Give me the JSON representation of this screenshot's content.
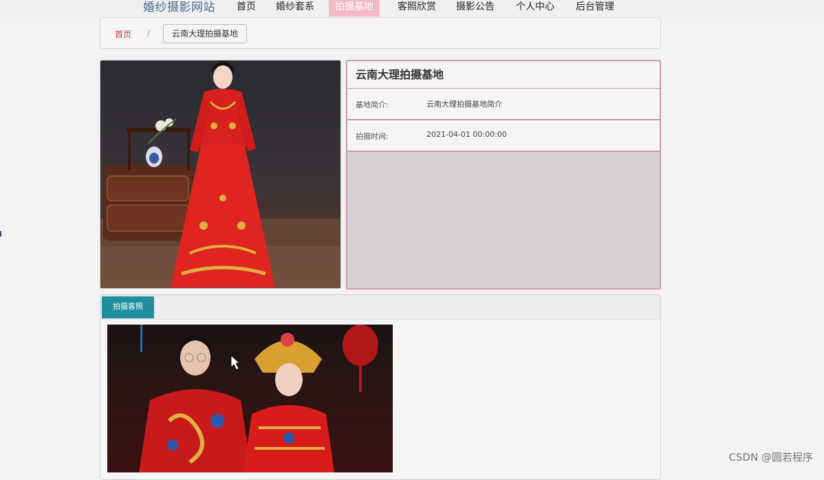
{
  "nav": {
    "brand": "婚纱摄影网站",
    "items": [
      "首页",
      "婚纱套系",
      "拍摄基地",
      "客照欣赏",
      "摄影公告",
      "个人中心",
      "后台管理"
    ],
    "active_index": 2
  },
  "breadcrumb": {
    "home": "首页",
    "separator": "/",
    "current": "云南大理拍摄基地"
  },
  "detail": {
    "title": "云南大理拍摄基地",
    "rows": [
      {
        "label": "基地简介:",
        "value": "云南大理拍摄基地简介"
      },
      {
        "label": "拍摄时间:",
        "value": "2021-04-01 00:00:00"
      }
    ]
  },
  "tabs": {
    "active_label": "拍摄客照"
  },
  "watermark": "CSDN @圆若程序",
  "colors": {
    "nav_active_bg": "#f3b9c6",
    "panel_border": "#c79aa8",
    "tab_active_bg": "#1f8fa0",
    "crumb_home": "#c0394b"
  }
}
